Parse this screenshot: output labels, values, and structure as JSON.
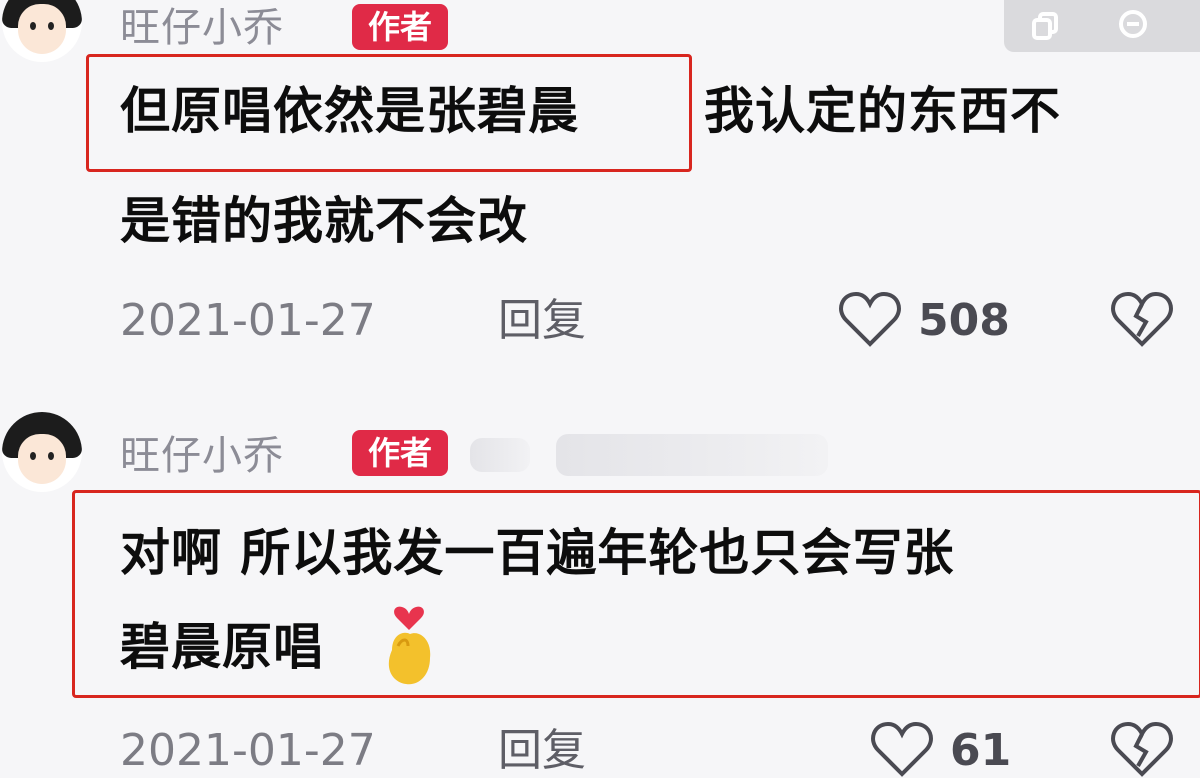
{
  "comments": [
    {
      "username": "旺仔小乔",
      "badge": "作者",
      "highlight": "但原唱依然是张碧晨",
      "rest_line1": "我认定的东西不",
      "line2": "是错的我就不会改",
      "date": "2021-01-27",
      "reply": "回复",
      "likes": "508"
    },
    {
      "username": "旺仔小乔",
      "badge": "作者",
      "line1": "对啊 所以我发一百遍年轮也只会写张",
      "line2": "碧晨原唱",
      "date": "2021-01-27",
      "reply": "回复",
      "likes": "61"
    }
  ],
  "colors": {
    "badge": "#e02a47",
    "highlight_box": "#d8261f"
  },
  "icons": [
    "copy-icon",
    "comment-icon",
    "heart-icon",
    "broken-heart-icon",
    "heart-hands-emoji"
  ]
}
